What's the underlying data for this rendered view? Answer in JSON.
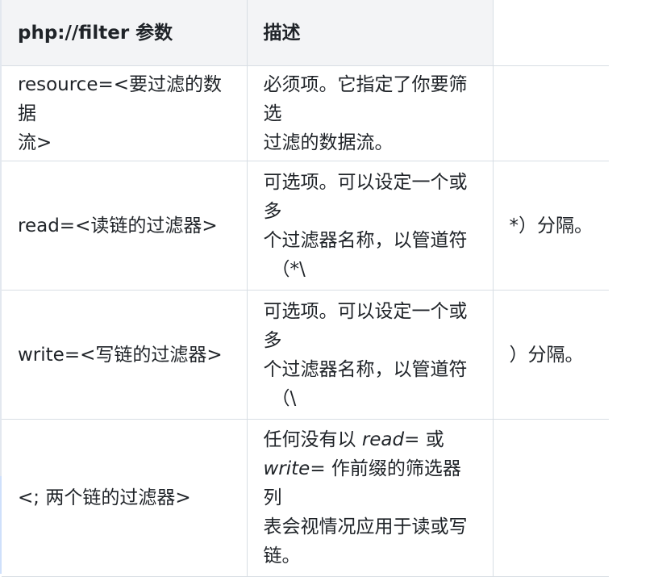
{
  "table": {
    "headers": [
      "php://filter 参数",
      "描述",
      ""
    ],
    "rows": [
      {
        "param": "resource=<要过滤的数据流>",
        "param_lines": [
          "resource=<要过滤的数据",
          "流>"
        ],
        "desc_lines": [
          "必须项。它指定了你要筛选",
          "过滤的数据流。"
        ],
        "extra": ""
      },
      {
        "param": "read=<读链的过滤器>",
        "desc_lines": [
          "可选项。可以设定一个或多",
          "个过滤器名称，以管道符",
          "（*\\"
        ],
        "extra": "*）分隔。"
      },
      {
        "param": "write=<写链的过滤器>",
        "desc_lines": [
          "可选项。可以设定一个或多",
          "个过滤器名称，以管道符",
          "（\\"
        ],
        "extra": "）分隔。"
      },
      {
        "param": "<; 两个链的过滤器>",
        "desc": {
          "part1": "任何没有以 ",
          "code1": "read=",
          "part2": " 或",
          "code2": "write=",
          "part3": " 作前缀的筛选器列",
          "line3": "表会视情况应用于读或写",
          "line4": "链。"
        },
        "extra": ""
      }
    ]
  }
}
